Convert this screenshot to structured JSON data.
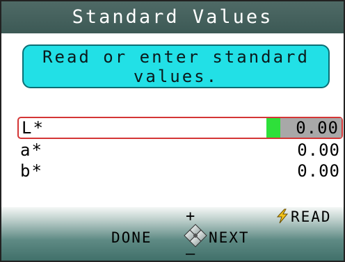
{
  "header": {
    "title": "Standard Values"
  },
  "instruction": {
    "line1": "Read or enter standard",
    "line2": "values."
  },
  "rows": [
    {
      "label": "L*",
      "value": "0.00",
      "selected": true
    },
    {
      "label": "a*",
      "value": "0.00",
      "selected": false
    },
    {
      "label": "b*",
      "value": "0.00",
      "selected": false
    }
  ],
  "footer": {
    "plus": "+",
    "minus": "–",
    "done_label": "DONE",
    "next_label": "NEXT",
    "read_label": "READ",
    "dpad_icon": "dpad-icon",
    "read_icon": "lightning-icon"
  },
  "colors": {
    "title_bg": "#3c5955",
    "instruction_bg": "#22e0e6",
    "selected_border": "#d43535",
    "cursor": "#2ee03a",
    "value_box": "#a8a8a8",
    "read_icon": "#f2c21b"
  }
}
